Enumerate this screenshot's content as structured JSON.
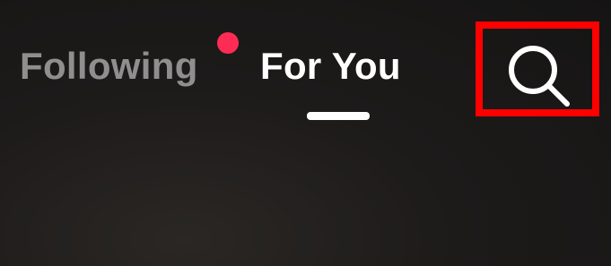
{
  "header": {
    "tabs": [
      {
        "label": "Following",
        "active": false,
        "has_notification": true
      },
      {
        "label": "For You",
        "active": true
      }
    ],
    "search": {
      "icon": "search-icon",
      "highlighted": true
    }
  },
  "colors": {
    "background": "#1b1a19",
    "active_tab": "#ffffff",
    "inactive_tab": "#8f8f8f",
    "notification_dot": "#fe2c55",
    "highlight_box": "#ff0000"
  }
}
